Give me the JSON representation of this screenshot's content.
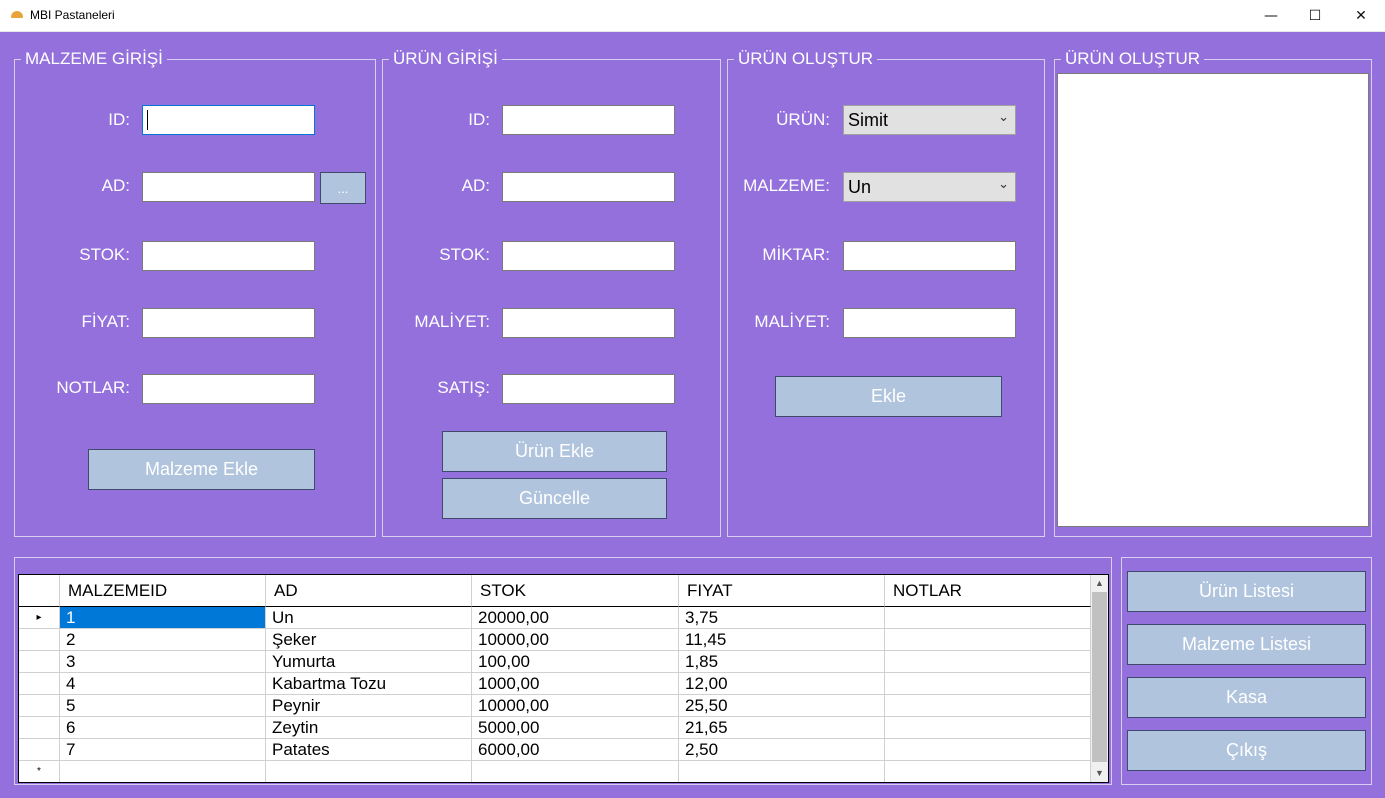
{
  "window": {
    "title": "MBI Pastaneleri",
    "minimize": "—",
    "maximize": "☐",
    "close": "✕"
  },
  "malzeme_girisi": {
    "legend": "MALZEME GİRİŞİ",
    "id_label": "ID:",
    "ad_label": "AD:",
    "stok_label": "STOK:",
    "fiyat_label": "FİYAT:",
    "notlar_label": "NOTLAR:",
    "browse_label": "...",
    "add_button": "Malzeme Ekle"
  },
  "urun_girisi": {
    "legend": "ÜRÜN GİRİŞİ",
    "id_label": "ID:",
    "ad_label": "AD:",
    "stok_label": "STOK:",
    "maliyet_label": "MALİYET:",
    "satis_label": "SATIŞ:",
    "add_button": "Ürün Ekle",
    "update_button": "Güncelle"
  },
  "urun_olustur": {
    "legend": "ÜRÜN OLUŞTUR",
    "urun_label": "ÜRÜN:",
    "urun_value": "Simit",
    "malzeme_label": "MALZEME:",
    "malzeme_value": "Un",
    "miktar_label": "MİKTAR:",
    "maliyet_label": "MALİYET:",
    "add_button": "Ekle"
  },
  "urun_olustur_list": {
    "legend": "ÜRÜN OLUŞTUR"
  },
  "grid": {
    "columns": [
      "MALZEMEID",
      "AD",
      "STOK",
      "FIYAT",
      "NOTLAR"
    ],
    "rows": [
      [
        "1",
        "Un",
        "20000,00",
        "3,75",
        ""
      ],
      [
        "2",
        "Şeker",
        "10000,00",
        "11,45",
        ""
      ],
      [
        "3",
        "Yumurta",
        "100,00",
        "1,85",
        ""
      ],
      [
        "4",
        "Kabartma Tozu",
        "1000,00",
        "12,00",
        ""
      ],
      [
        "5",
        "Peynir",
        "10000,00",
        "25,50",
        ""
      ],
      [
        "6",
        "Zeytin",
        "5000,00",
        "21,65",
        ""
      ],
      [
        "7",
        "Patates",
        "6000,00",
        "2,50",
        ""
      ]
    ],
    "current_marker": "▸",
    "new_row_marker": "*"
  },
  "nav": {
    "urun_listesi": "Ürün Listesi",
    "malzeme_listesi": "Malzeme Listesi",
    "kasa": "Kasa",
    "cikis": "Çıkış"
  },
  "colors": {
    "background": "#9370db",
    "button": "#b0c4de",
    "selection": "#0078d7"
  }
}
